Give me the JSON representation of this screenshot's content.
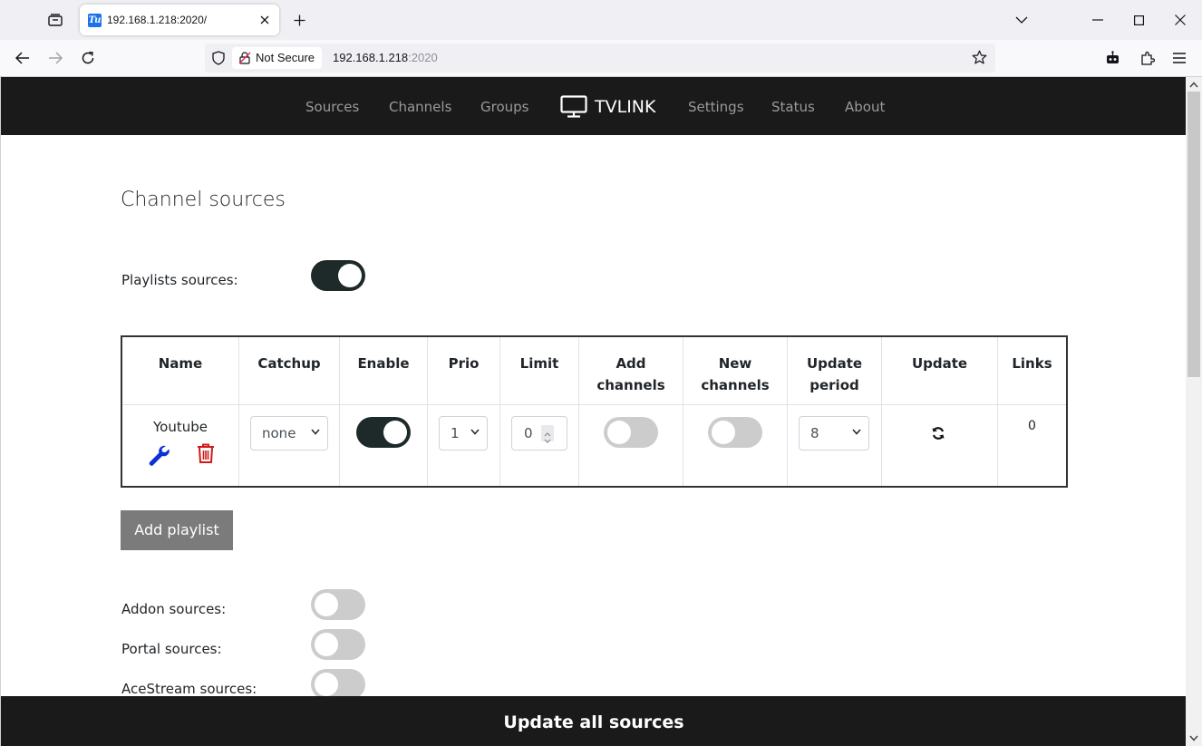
{
  "browser": {
    "tab_title": "192.168.1.218:2020/",
    "favicon_text": "Tu",
    "not_secure_label": "Not Secure",
    "url_host": "192.168.1.218",
    "url_port": ":2020"
  },
  "app_nav": {
    "items": [
      "Sources",
      "Channels",
      "Groups",
      "Settings",
      "Status",
      "About"
    ],
    "brand": "TVLINK"
  },
  "page": {
    "title": "Channel sources",
    "playlists_label": "Playlists sources:",
    "playlists_enabled": true,
    "add_playlist_label": "Add playlist",
    "addon_label": "Addon sources:",
    "addon_enabled": false,
    "portal_label": "Portal sources:",
    "portal_enabled": false,
    "acestream_label": "AceStream sources:",
    "acestream_enabled": false,
    "update_all_label": "Update all sources"
  },
  "table": {
    "headers": {
      "name": "Name",
      "catchup": "Catchup",
      "enable": "Enable",
      "prio": "Prio",
      "limit": "Limit",
      "add_channels_1": "Add",
      "add_channels_2": "channels",
      "new_channels_1": "New",
      "new_channels_2": "channels",
      "update_period_1": "Update",
      "update_period_2": "period",
      "update": "Update",
      "links": "Links"
    },
    "rows": [
      {
        "name": "Youtube",
        "catchup": "none",
        "enabled": true,
        "prio": "1",
        "limit": "0",
        "add_channels": false,
        "new_channels": false,
        "update_period": "8",
        "links": "0"
      }
    ]
  },
  "colors": {
    "nav_bg": "#1a1a1a",
    "toggle_on": "#1e2a2a",
    "toggle_off": "#cccccc",
    "edit_icon": "#0d2fd6",
    "delete_icon": "#d11a1a",
    "add_button": "#7b7b7b"
  }
}
